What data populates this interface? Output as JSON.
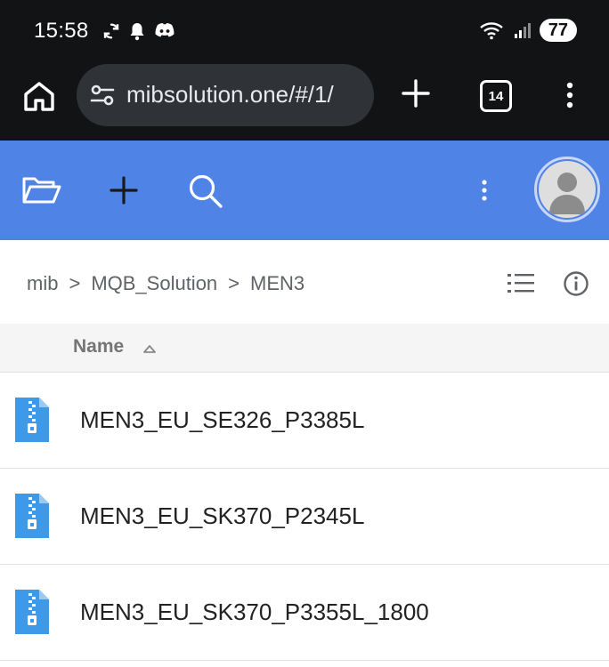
{
  "status_bar": {
    "time": "15:58",
    "battery": "77",
    "icons": [
      "sync-icon",
      "bell-icon",
      "discord-icon",
      "wifi-icon",
      "signal-icon"
    ]
  },
  "browser": {
    "url": "mibsolution.one/#/1/",
    "tab_count": "14",
    "icons": [
      "home-icon",
      "site-settings-icon",
      "plus-icon",
      "menu-dots-icon"
    ]
  },
  "toolbar": {
    "color": "#5083e6",
    "icons": [
      "folder-open-icon",
      "plus-icon",
      "search-icon",
      "more-vert-icon",
      "user-avatar-icon"
    ]
  },
  "breadcrumb": {
    "items": [
      "mib",
      "MQB_Solution",
      "MEN3"
    ],
    "separator": ">"
  },
  "list": {
    "column_name": "Name",
    "sort": "ascending",
    "files": [
      {
        "name": "MEN3_EU_SE326_P3385L",
        "icon": "zip-file-icon"
      },
      {
        "name": "MEN3_EU_SK370_P2345L",
        "icon": "zip-file-icon"
      },
      {
        "name": "MEN3_EU_SK370_P3355L_1800",
        "icon": "zip-file-icon"
      }
    ]
  }
}
